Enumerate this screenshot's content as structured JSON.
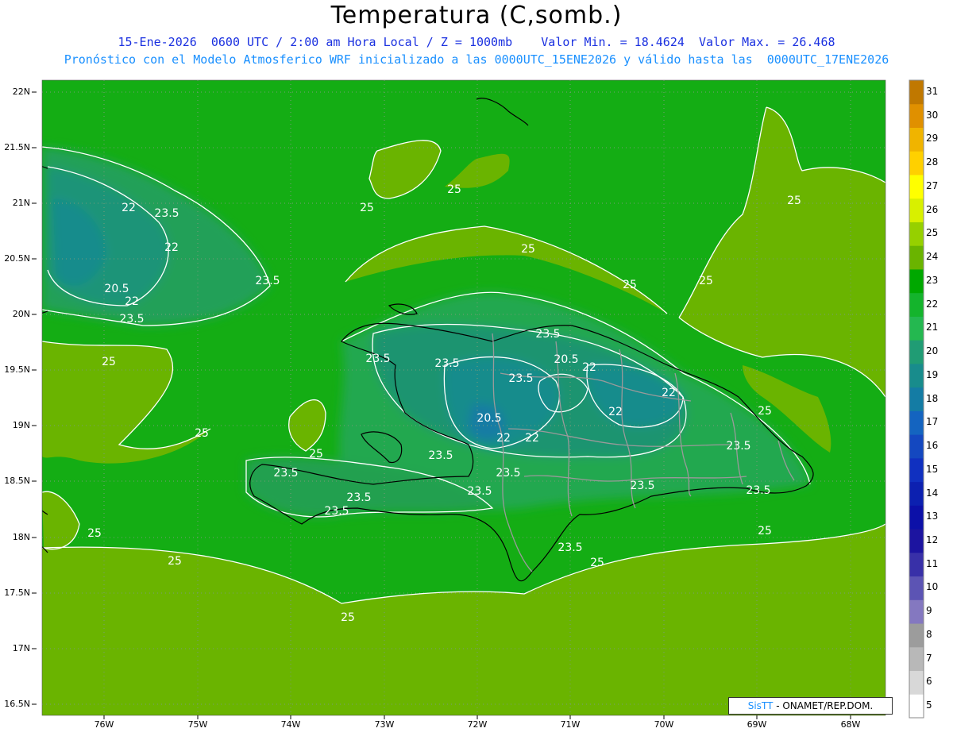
{
  "header": {
    "title": "Temperatura (C,somb.)",
    "line1": "15-Ene-2026  0600 UTC / 2:00 am Hora Local / Z = 1000mb    Valor Min. = 18.4624  Valor Max. = 26.468",
    "line2": "Pronóstico con el Modelo Atmosferico WRF inicializado a las 0000UTC_15ENE2026 y válido hasta las  0000UTC_17ENE2026"
  },
  "axes": {
    "lat_labels": [
      "22N",
      "21.5N",
      "21N",
      "20.5N",
      "20N",
      "19.5N",
      "19N",
      "18.5N",
      "18N",
      "17.5N",
      "17N",
      "16.5N"
    ],
    "lon_labels": [
      "76W",
      "75W",
      "74W",
      "73W",
      "72W",
      "71W",
      "70W",
      "69W",
      "68W"
    ]
  },
  "colorbar": {
    "labels": [
      "31",
      "30",
      "29",
      "28",
      "27",
      "26",
      "25",
      "24",
      "23",
      "22",
      "21",
      "20",
      "19",
      "18",
      "17",
      "16",
      "15",
      "14",
      "13",
      "12",
      "11",
      "10",
      "9",
      "8",
      "7",
      "6",
      "5"
    ],
    "colors": [
      "#c07800",
      "#e09000",
      "#f0b400",
      "#ffd000",
      "#ffff00",
      "#d8f000",
      "#96d000",
      "#6ab400",
      "#00a800",
      "#14b42c",
      "#24b850",
      "#209c74",
      "#188c8c",
      "#147ca4",
      "#1464c0",
      "#1448c0",
      "#1030c0",
      "#0c20b0",
      "#0c10a8",
      "#1c14a0",
      "#3830a8",
      "#5c54b4",
      "#8478c0",
      "#9c9c9c",
      "#b8b8b8",
      "#d8d8d8",
      "#ffffff"
    ]
  },
  "contours": {
    "labels": [
      "25",
      "25",
      "25",
      "25",
      "25",
      "25",
      "25",
      "25",
      "25",
      "25",
      "25",
      "25",
      "25",
      "25",
      "25",
      "22",
      "23.5",
      "22",
      "23.5",
      "20.5",
      "22",
      "23.5",
      "23.5",
      "23.5",
      "20.5",
      "22",
      "22",
      "22",
      "23.5",
      "23.5",
      "20.5",
      "22",
      "22",
      "23.5",
      "23.5",
      "23.5",
      "23.5",
      "23.5",
      "23.5",
      "23.5",
      "23.5",
      "23.5",
      "23.5"
    ]
  },
  "credit": {
    "brand": "SisTT",
    "org": " - ONAMET/REP.DOM."
  }
}
